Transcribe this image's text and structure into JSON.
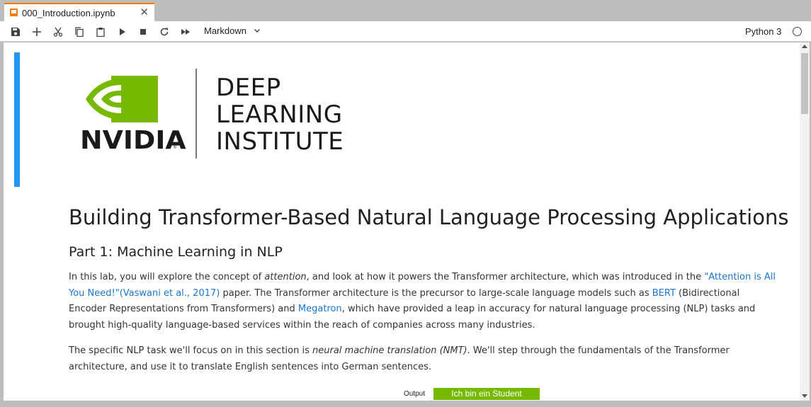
{
  "tab": {
    "title": "000_Introduction.ipynb",
    "close_glyph": "✕"
  },
  "toolbar": {
    "icons": [
      "save-icon",
      "add-cell-icon",
      "cut-icon",
      "copy-icon",
      "paste-icon",
      "run-icon",
      "stop-icon",
      "restart-icon",
      "run-all-icon"
    ],
    "cell_type": "Markdown",
    "kernel": "Python 3"
  },
  "logo": {
    "nvidia": "NVIDIA",
    "registered": "®",
    "dli_lines": [
      "DEEP",
      "LEARNING",
      "INSTITUTE"
    ],
    "brand_green": "#76b900"
  },
  "content": {
    "title": "Building Transformer-Based Natural Language Processing Applications",
    "subtitle": "Part 1: Machine Learning in NLP",
    "p1": {
      "t1": "In this lab, you will explore the concept of ",
      "em1": "attention",
      "t2": ", and look at how it powers the Transformer architecture, which was introduced in the ",
      "link1": "\"Attention is All You Need!\"(Vaswani et al., 2017)",
      "t3": " paper. The Transformer architecture is the precursor to large-scale language models such as ",
      "link2": "BERT",
      "t4": " (Bidirectional Encoder Representations from Transformers) and ",
      "link3": "Megatron",
      "t5": ", which have provided a leap in accuracy for natural language processing (NLP) tasks and brought high-quality language-based services within the reach of companies across many industries."
    },
    "p2": {
      "t1": "The specific NLP task we'll focus on in this section is ",
      "em1": "neural machine translation (NMT)",
      "t2": ". We'll step through the fundamentals of the Transformer architecture, and use it to translate English sentences into German sentences."
    },
    "diagram": {
      "output_label": "Output",
      "output_text": "Ich bin ein Student"
    }
  },
  "colors": {
    "accent": "#2196f3",
    "tab_accent": "#f57c00",
    "link": "#1976d2"
  }
}
